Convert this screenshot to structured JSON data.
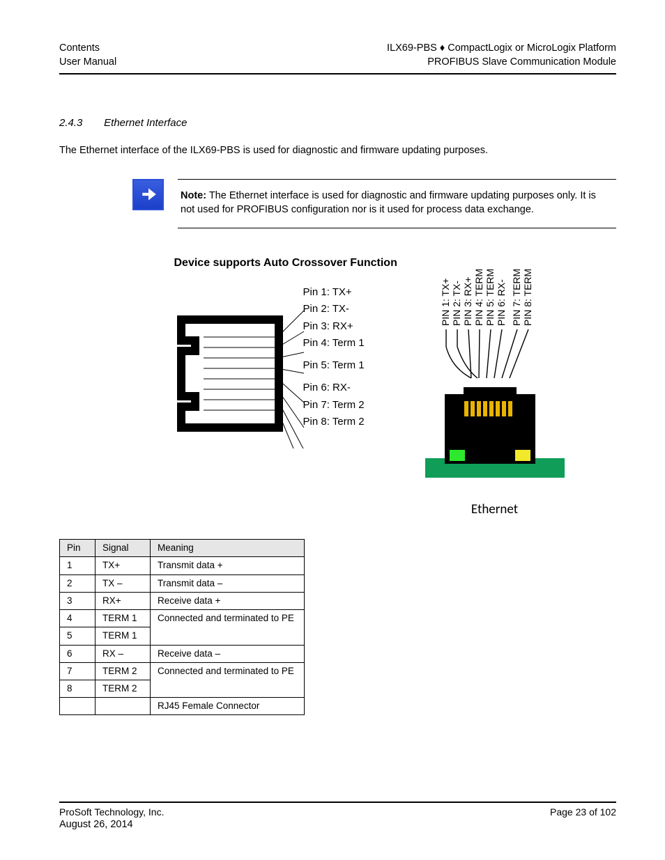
{
  "header": {
    "left_line1": "Contents",
    "left_line2": "User Manual",
    "right_line1": "ILX69-PBS ♦ CompactLogix or MicroLogix Platform",
    "right_line2": "PROFIBUS Slave Communication Module"
  },
  "section": {
    "number": "2.4.3",
    "title": "Ethernet Interface"
  },
  "intro": "The Ethernet interface of the ILX69-PBS is used for diagnostic and firmware updating purposes.",
  "note": {
    "bold": "Note:",
    "text": " The Ethernet interface is used for diagnostic and firmware updating purposes only. It is not used for PROFIBUS configuration nor is it used for process data exchange."
  },
  "left_caption": "Device supports Auto Crossover Function",
  "pin_labels": [
    "Pin 1: TX+",
    "Pin 2: TX-",
    "Pin 3: RX+",
    "Pin 4: Term 1",
    "Pin 5: Term 1",
    "Pin 6: RX-",
    "Pin 7: Term 2",
    "Pin 8: Term 2"
  ],
  "vertical_labels": [
    "PIN 1: TX+",
    "PIN 2: TX-",
    "PIN 3: RX+",
    "PIN 4: TERM",
    "PIN 5: TERM",
    "PIN 6: RX-",
    "PIN 7: TERM",
    "PIN 8: TERM"
  ],
  "ethernet_label": "Ethernet",
  "table": {
    "headers": [
      "Pin",
      "Signal",
      "Meaning"
    ],
    "rows": [
      [
        "1",
        "TX+",
        "Transmit data +"
      ],
      [
        "2",
        "TX –",
        "Transmit data –"
      ],
      [
        "3",
        "RX+",
        "Receive data +"
      ],
      [
        "4",
        "TERM 1",
        ""
      ],
      [
        "5",
        "TERM 1",
        ""
      ],
      [
        "6",
        "RX –",
        "Receive data –"
      ],
      [
        "7",
        "TERM 2",
        ""
      ],
      [
        "8",
        "TERM 2",
        ""
      ],
      [
        "",
        "",
        "RJ45 Female Connector"
      ]
    ],
    "merged_45": "Connected and terminated to PE",
    "merged_78": "Connected and terminated to PE"
  },
  "footer": {
    "left": "ProSoft Technology, Inc.",
    "right": "Page 23 of 102",
    "date": "August 26, 2014"
  }
}
